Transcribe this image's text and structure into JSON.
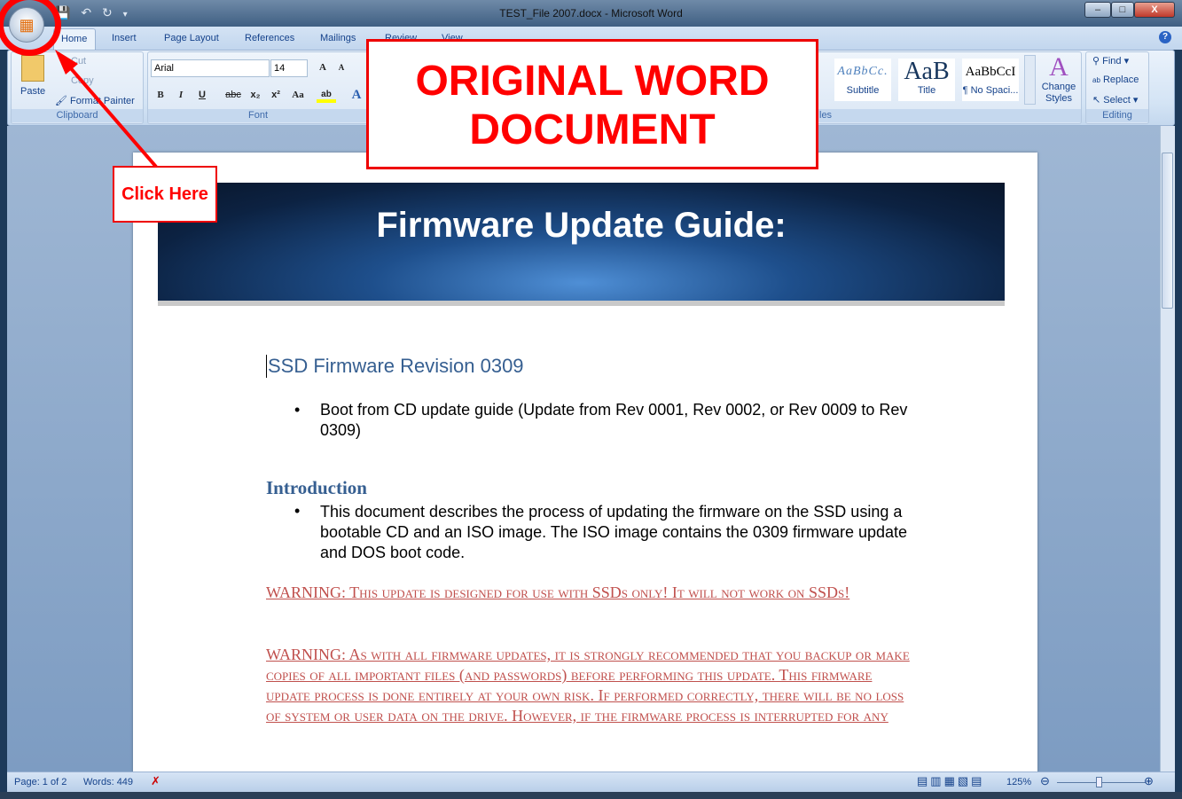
{
  "window": {
    "title": "TEST_File 2007.docx - Microsoft Word",
    "minimize": "–",
    "maximize": "□",
    "close": "X"
  },
  "qat": {
    "save": "💾",
    "undo": "↶",
    "redo": "↻",
    "customize": "▾"
  },
  "tabs": [
    "Home",
    "Insert",
    "Page Layout",
    "References",
    "Mailings",
    "Review",
    "View"
  ],
  "help": "?",
  "clipboard": {
    "paste": "Paste",
    "cut": "Cut",
    "copy": "Copy",
    "format_painter": "Format Painter",
    "label": "Clipboard"
  },
  "font": {
    "name": "Arial",
    "size": "14",
    "grow": "A",
    "shrink": "A",
    "bold": "B",
    "italic": "I",
    "underline": "U",
    "strike": "abc",
    "sub": "x₂",
    "sup": "x²",
    "case": "Aa",
    "highlight": "ab",
    "color": "A",
    "label": "Font"
  },
  "styles": {
    "items": [
      {
        "preview": "AaBbCc.",
        "name": "Subtitle"
      },
      {
        "preview": "AaB",
        "name": "Title"
      },
      {
        "preview": "AaBbCcI",
        "name": "¶ No Spaci..."
      }
    ],
    "change": "Change Styles",
    "label": "les"
  },
  "editing": {
    "find": "Find",
    "replace": "Replace",
    "select": "Select",
    "label": "Editing"
  },
  "document": {
    "banner_title": "Firmware Update Guide:",
    "heading": "SSD Firmware Revision 0309",
    "bullet1": "Boot from CD update guide (Update from Rev 0001, Rev 0002, or Rev 0009 to Rev 0309)",
    "intro_heading": "Introduction",
    "bullet2": "This document describes the process of updating the firmware on the SSD using a bootable CD and an ISO image. The ISO image contains the 0309 firmware update and DOS boot code.",
    "warning1": "WARNING: This update is designed for use with SSDs only! It will not work on SSDs!",
    "warning2": "WARNING: As with all firmware updates, it is strongly recommended that you backup or make copies of all important files (and passwords) before performing this update. This firmware update process is done entirely at your own risk. If performed correctly, there will be no loss of system or user data on the drive. However, if the firmware process is interrupted for any"
  },
  "status": {
    "page": "Page: 1 of 2",
    "words": "Words: 449",
    "zoom": "125%"
  },
  "annotations": {
    "callout": "ORIGINAL WORD DOCUMENT",
    "click_here": "Click Here",
    "color": "#ff0000"
  }
}
